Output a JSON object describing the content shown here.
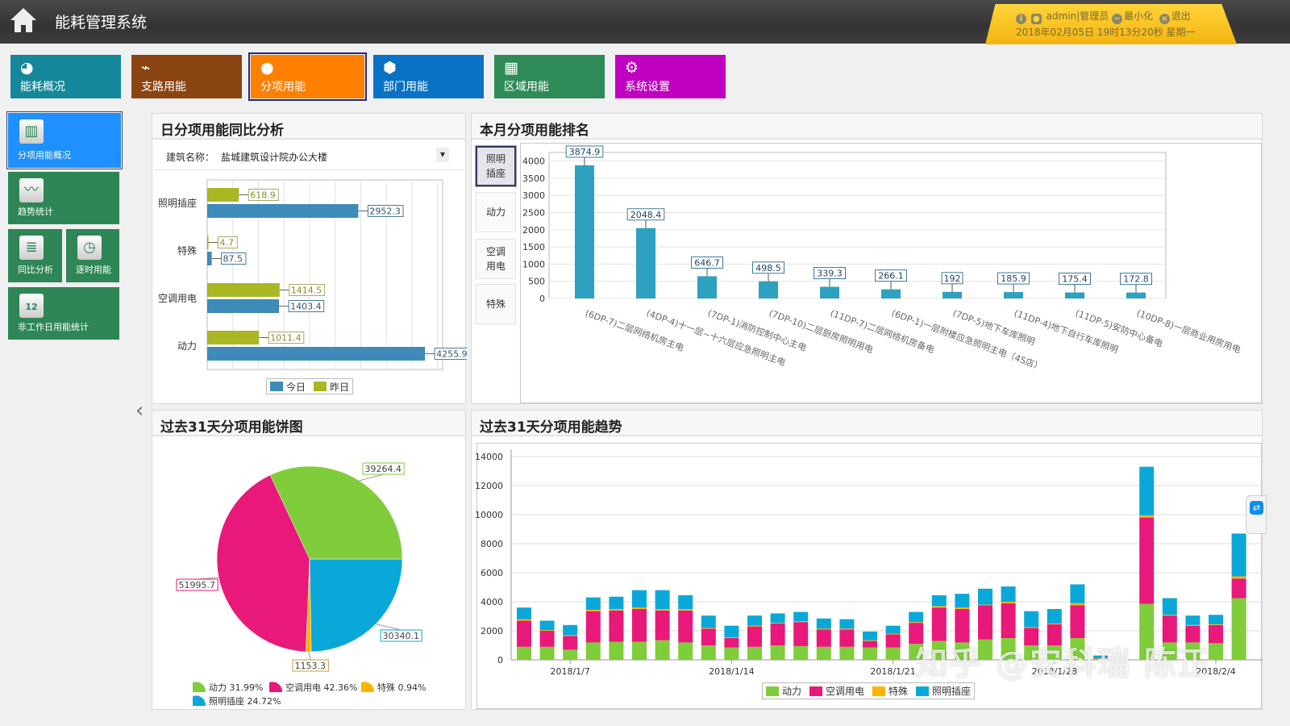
{
  "header": {
    "title": "能耗管理系统",
    "user": "admin|管理员",
    "minimize": "最小化",
    "logout": "退出",
    "datetime": "2018年02月05日 19时13分20秒 星期一"
  },
  "nav": [
    {
      "label": "能耗概况",
      "icon": "chart-gauge-icon",
      "color": "#15879a"
    },
    {
      "label": "支路用能",
      "icon": "presentation-chart-icon",
      "color": "#8b4513"
    },
    {
      "label": "分项用能",
      "icon": "user-icon",
      "color": "#ff8000",
      "active": true
    },
    {
      "label": "部门用能",
      "icon": "cube-icon",
      "color": "#0a72c4"
    },
    {
      "label": "区域用能",
      "icon": "grid-icon",
      "color": "#2e8b57"
    },
    {
      "label": "系统设置",
      "icon": "gear-icon",
      "color": "#c000c0"
    }
  ],
  "sidebar": [
    {
      "label": "分项用能概况",
      "icon": "book-icon",
      "color": "#1e90ff",
      "active": true
    },
    {
      "label": "趋势统计",
      "icon": "trend-line-icon",
      "color": "#2e8555"
    },
    {
      "label": "同比分析",
      "icon": "database-icon",
      "color": "#2e8555"
    },
    {
      "label": "逐时用能",
      "icon": "clock-icon",
      "color": "#2e8555"
    },
    {
      "label": "非工作日用能统计",
      "icon": "calendar-icon",
      "color": "#2e8555",
      "icon_text": "12"
    }
  ],
  "panels": {
    "daily": "日分项用能同比分析",
    "ranking": "本月分项用能排名",
    "pie": "过去31天分项用能饼图",
    "trend": "过去31天分项用能趋势"
  },
  "filter": {
    "label": "建筑名称：",
    "value": "盐城建筑设计院办公大楼"
  },
  "ranking_buttons": [
    "照明插座",
    "动力",
    "空调用电",
    "特殊"
  ],
  "ranking_selected": "照明插座",
  "watermark": "知乎 @安科瑞 陈正",
  "chart_data": [
    {
      "type": "bar",
      "orientation": "horizontal",
      "categories": [
        "照明插座",
        "特殊",
        "空调用电",
        "动力"
      ],
      "series": [
        {
          "name": "今日",
          "color": "#3e8ab8",
          "values": [
            2952.3,
            87.5,
            1403.4,
            4255.9
          ]
        },
        {
          "name": "昨日",
          "color": "#a8b722",
          "values": [
            618.9,
            4.7,
            1414.5,
            1011.4
          ]
        }
      ],
      "xlim": [
        0,
        4600
      ],
      "grid": true,
      "legend": "bottom"
    },
    {
      "type": "bar",
      "categories": [
        "(6DP-7)二层网络机房主电",
        "(4DP-4)十一层~十六层应急照明主电",
        "(7DP-1)消防控制中心主电",
        "(7DP-10)二层厨房照明用电",
        "(11DP-7)二层网络机房备电",
        "(6DP-1)一层附楼应急照明主电（4S店）",
        "(7DP-5)地下车库照明",
        "(11DP-4)地下自行车库照明",
        "(11DP-5)安防中心备电",
        "(10DP-8)一层商业用房用电"
      ],
      "values": [
        3874.9,
        2048.4,
        646.7,
        498.5,
        339.3,
        266.1,
        192,
        185.9,
        175.4,
        172.8
      ],
      "color": "#2ea0c0",
      "yticks": [
        0,
        500,
        1000,
        1500,
        2000,
        2500,
        3000,
        3500,
        4000
      ],
      "ylim": [
        0,
        4250
      ],
      "grid": true
    },
    {
      "type": "pie",
      "series": [
        {
          "name": "照明插座",
          "value": 30340.1,
          "percent": "24.72%",
          "color": "#0aa8d8"
        },
        {
          "name": "特殊",
          "value": 1153.3,
          "percent": "0.94%",
          "color": "#ffb400"
        },
        {
          "name": "空调用电",
          "value": 51995.7,
          "percent": "42.36%",
          "color": "#e8197a"
        },
        {
          "name": "动力",
          "value": 39264.4,
          "percent": "31.99%",
          "color": "#7fcd3a"
        }
      ],
      "legend": "bottom"
    },
    {
      "type": "bar",
      "stacked": true,
      "x": [
        "2018/1/5",
        "2018/1/6",
        "2018/1/7",
        "2018/1/8",
        "2018/1/9",
        "2018/1/10",
        "2018/1/11",
        "2018/1/12",
        "2018/1/13",
        "2018/1/14",
        "2018/1/15",
        "2018/1/16",
        "2018/1/17",
        "2018/1/18",
        "2018/1/19",
        "2018/1/20",
        "2018/1/21",
        "2018/1/22",
        "2018/1/23",
        "2018/1/24",
        "2018/1/25",
        "2018/1/26",
        "2018/1/27",
        "2018/1/28",
        "2018/1/29",
        "2018/1/30",
        "2018/1/31",
        "2018/2/1",
        "2018/2/2",
        "2018/2/3",
        "2018/2/4",
        "2018/2/5"
      ],
      "xticks": [
        "2018/1/7",
        "2018/1/14",
        "2018/1/21",
        "2018/1/28",
        "2018/2/4"
      ],
      "yticks": [
        0,
        2000,
        4000,
        6000,
        8000,
        10000,
        12000,
        14000
      ],
      "ylim": [
        0,
        14500
      ],
      "grid": true,
      "legend": "bottom",
      "series": [
        {
          "name": "动力",
          "color": "#7fcd3a",
          "values": [
            900,
            900,
            700,
            1200,
            1250,
            1250,
            1350,
            1200,
            1000,
            850,
            900,
            1000,
            950,
            900,
            900,
            850,
            850,
            1100,
            1300,
            1200,
            1400,
            1500,
            1000,
            1000,
            1500,
            100,
            0,
            3850,
            1200,
            1200,
            1150,
            4250
          ]
        },
        {
          "name": "空调用电",
          "color": "#e8197a",
          "values": [
            1800,
            1100,
            950,
            2150,
            2150,
            2250,
            2050,
            2200,
            1150,
            650,
            1400,
            1500,
            1650,
            1200,
            1200,
            450,
            900,
            1450,
            2300,
            2300,
            2350,
            2400,
            1200,
            1450,
            2250,
            50,
            0,
            5950,
            1850,
            1150,
            1250,
            1350
          ]
        },
        {
          "name": "特殊",
          "color": "#ffb400",
          "values": [
            100,
            50,
            50,
            100,
            100,
            100,
            100,
            100,
            50,
            50,
            50,
            50,
            50,
            50,
            50,
            50,
            50,
            50,
            100,
            100,
            50,
            100,
            50,
            50,
            150,
            0,
            0,
            150,
            50,
            50,
            50,
            150
          ]
        },
        {
          "name": "照明插座",
          "color": "#0aa8d8",
          "values": [
            800,
            650,
            700,
            850,
            850,
            1200,
            1300,
            950,
            850,
            800,
            700,
            650,
            650,
            700,
            650,
            600,
            550,
            700,
            750,
            950,
            1100,
            1050,
            1100,
            1000,
            1300,
            150,
            0,
            3350,
            1150,
            650,
            650,
            2950
          ]
        }
      ]
    }
  ]
}
